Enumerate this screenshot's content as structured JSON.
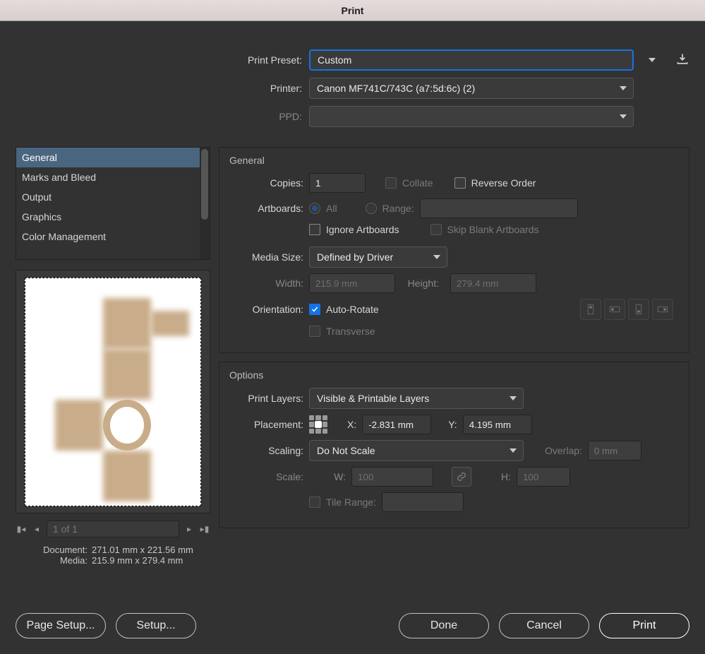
{
  "titlebar": {
    "title": "Print"
  },
  "top": {
    "preset_label": "Print Preset:",
    "preset_value": "Custom",
    "printer_label": "Printer:",
    "printer_value": "Canon MF741C/743C (a7:5d:6c) (2)",
    "ppd_label": "PPD:",
    "ppd_value": ""
  },
  "categories": [
    "General",
    "Marks and Bleed",
    "Output",
    "Graphics",
    "Color Management"
  ],
  "selected_category": 0,
  "preview": {
    "page_of": "1 of 1",
    "doc_label": "Document:",
    "doc_value": "271.01 mm x 221.56 mm",
    "media_label": "Media:",
    "media_value": "215.9 mm x 279.4 mm"
  },
  "general": {
    "title": "General",
    "copies_label": "Copies:",
    "copies_value": "1",
    "collate_label": "Collate",
    "reverse_label": "Reverse Order",
    "artboards_label": "Artboards:",
    "all_label": "All",
    "range_label": "Range:",
    "range_value": "",
    "ignore_label": "Ignore Artboards",
    "skip_label": "Skip Blank Artboards",
    "media_size_label": "Media Size:",
    "media_size_value": "Defined by Driver",
    "width_label": "Width:",
    "width_value": "215.9 mm",
    "height_label": "Height:",
    "height_value": "279.4 mm",
    "orientation_label": "Orientation:",
    "auto_rotate_label": "Auto-Rotate",
    "transverse_label": "Transverse"
  },
  "options": {
    "title": "Options",
    "print_layers_label": "Print Layers:",
    "print_layers_value": "Visible & Printable Layers",
    "placement_label": "Placement:",
    "x_label": "X:",
    "x_value": "-2.831 mm",
    "y_label": "Y:",
    "y_value": "4.195 mm",
    "scaling_label": "Scaling:",
    "scaling_value": "Do Not Scale",
    "overlap_label": "Overlap:",
    "overlap_value": "0 mm",
    "scale_label": "Scale:",
    "w_label": "W:",
    "w_value": "100",
    "h_label": "H:",
    "h_value": "100",
    "tile_label": "Tile Range:",
    "tile_value": ""
  },
  "footer": {
    "page_setup": "Page Setup...",
    "setup": "Setup...",
    "done": "Done",
    "cancel": "Cancel",
    "print": "Print"
  }
}
